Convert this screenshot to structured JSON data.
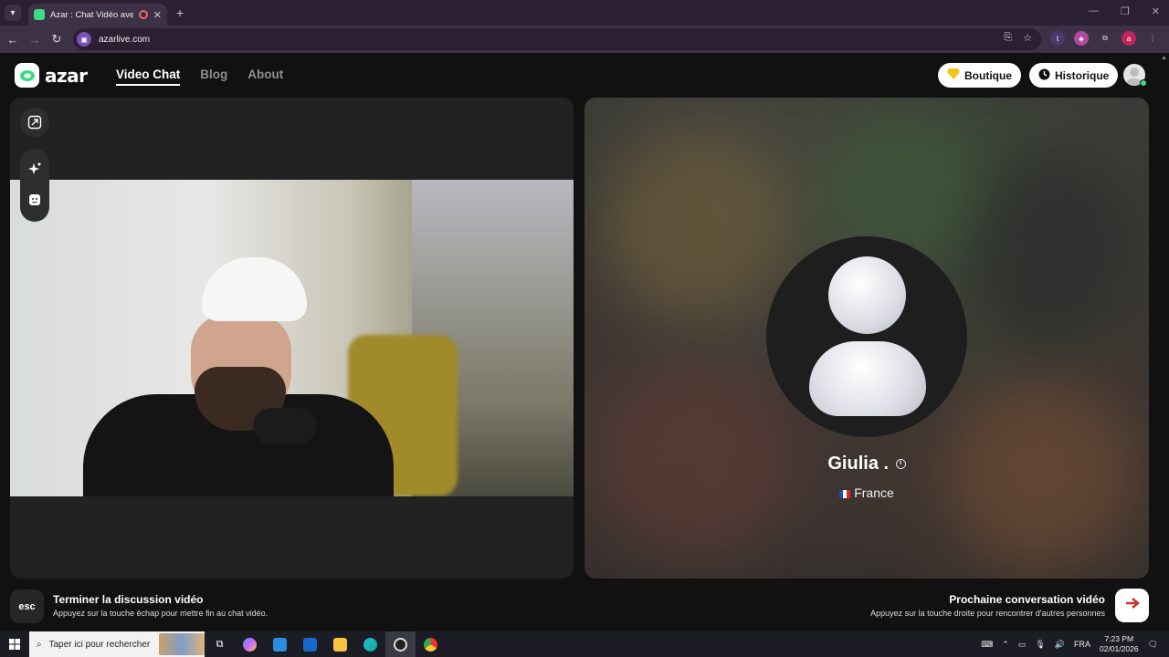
{
  "browser": {
    "tab_title": "Azar : Chat Vidéo avec de n",
    "url": "azarlive.com"
  },
  "header": {
    "logo_text": "azar",
    "nav": [
      {
        "label": "Video Chat",
        "active": true
      },
      {
        "label": "Blog",
        "active": false
      },
      {
        "label": "About",
        "active": false
      }
    ],
    "shop_label": "Boutique",
    "history_label": "Historique"
  },
  "peer": {
    "name": "Giulia .",
    "country": "France"
  },
  "bottom": {
    "esc_key": "esc",
    "end_title": "Terminer la discussion vidéo",
    "end_sub": "Appuyez sur la touche échap pour mettre fin au chat vidéo.",
    "next_title": "Prochaine conversation vidéo",
    "next_sub": "Appuyez sur la touche droite pour rencontrer d'autres personnes"
  },
  "taskbar": {
    "search_placeholder": "Taper ici pour rechercher",
    "language": "FRA",
    "time": "7:23 PM",
    "date": "02/01/2026"
  },
  "colors": {
    "accent_green": "#3ddc84",
    "background": "#111111",
    "panel": "#222222"
  }
}
